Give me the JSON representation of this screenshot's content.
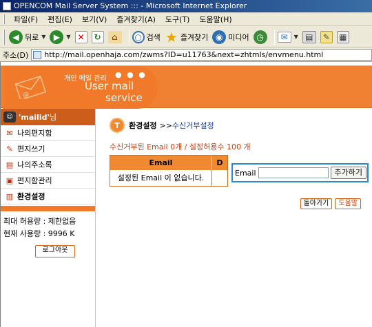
{
  "window": {
    "title": "OPENCOM Mail Server System ::: - Microsoft Internet Explorer"
  },
  "menubar": {
    "items": [
      "파일(F)",
      "편집(E)",
      "보기(V)",
      "즐겨찾기(A)",
      "도구(T)",
      "도움말(H)"
    ]
  },
  "toolbar": {
    "back_label": "뒤로",
    "search_label": "검색",
    "favorites_label": "즐겨찾기",
    "media_label": "미디어"
  },
  "address": {
    "label": "주소(D)",
    "url": "http://mail.openhaja.com/zwms?ID=u11763&next=zhtmls/envmenu.html"
  },
  "header": {
    "title_ko": "개인 메일 관리",
    "dots": "● ● ●",
    "title_en_1": "User mail",
    "title_en_2": "service"
  },
  "sidebar": {
    "user_name": "'mailid'",
    "user_suffix": " 님",
    "items": [
      {
        "label": "나의편지함",
        "icon": "mailbox-icon"
      },
      {
        "label": "편지쓰기",
        "icon": "pen-icon"
      },
      {
        "label": "나의주소록",
        "icon": "addressbook-icon"
      },
      {
        "label": "편지함관리",
        "icon": "folder-manage-icon"
      },
      {
        "label": "환경설정",
        "icon": "settings-doc-icon"
      }
    ],
    "quota_max": "최대 허용량 : 제한없음",
    "quota_used": "현재 사용량 : 9996 K",
    "logout_label": "로그아웃"
  },
  "main": {
    "crumb_main": "환경설정",
    "crumb_sep": ">>",
    "crumb_sub": "수신거부설정",
    "count_text": "수신거부된 Email 0개 / 설정허용수 100 개",
    "table": {
      "col_email": "Email",
      "col_d": "D",
      "empty_text": "설정된 Email 이 없습니다."
    },
    "add": {
      "label": "Email",
      "value": "",
      "button_label": "추가하기"
    },
    "back_button": "돌아가기",
    "help_button": "도움말"
  },
  "colors": {
    "accent_orange": "#f08032",
    "selection_blue": "#2a8ad6",
    "link_blue": "#1a3a9a",
    "alert_red": "#d04010"
  }
}
